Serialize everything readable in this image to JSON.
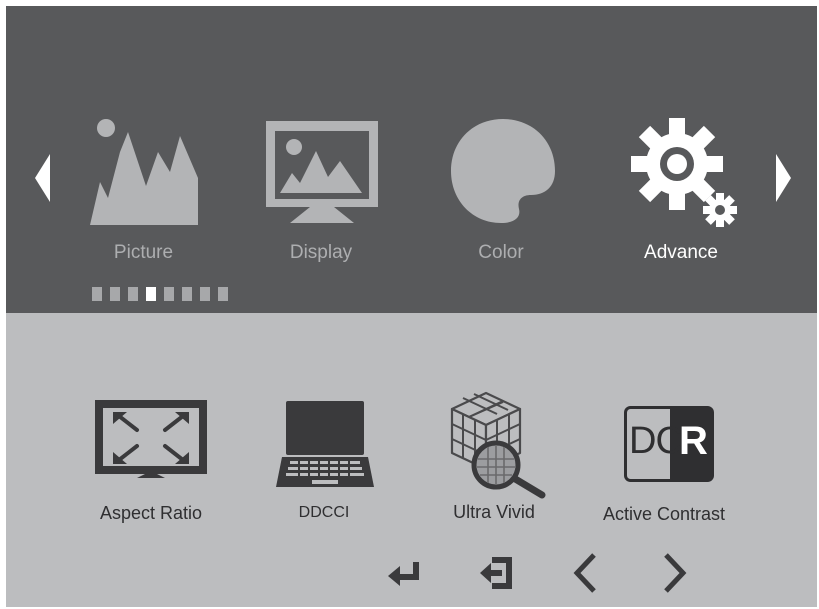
{
  "osd": {
    "tabs": [
      {
        "label": "Picture",
        "icon": "picture-icon"
      },
      {
        "label": "Display",
        "icon": "display-icon"
      },
      {
        "label": "Color",
        "icon": "color-palette-icon"
      },
      {
        "label": "Advance",
        "icon": "gears-icon"
      }
    ],
    "active_tab": "Advance",
    "page_indicator": {
      "count": 8,
      "active_index": 3
    },
    "items": [
      {
        "label": "Aspect Ratio",
        "icon": "aspect-ratio-icon"
      },
      {
        "label": "DDCCI",
        "icon": "laptop-icon"
      },
      {
        "label": "Ultra Vivid",
        "icon": "cube-magnifier-icon"
      },
      {
        "label": "Active Contrast",
        "icon": "dcr-icon"
      }
    ],
    "dcr_text": {
      "dc": "DC",
      "r": "R"
    },
    "nav": [
      "enter-icon",
      "exit-icon",
      "chevron-left-icon",
      "chevron-right-icon"
    ],
    "colors": {
      "top_panel": "#58595b",
      "bottom_panel": "#bcbdbf",
      "icon_light": "#b3b4b6",
      "icon_dark": "#3a3a3c",
      "active": "#ffffff"
    }
  }
}
